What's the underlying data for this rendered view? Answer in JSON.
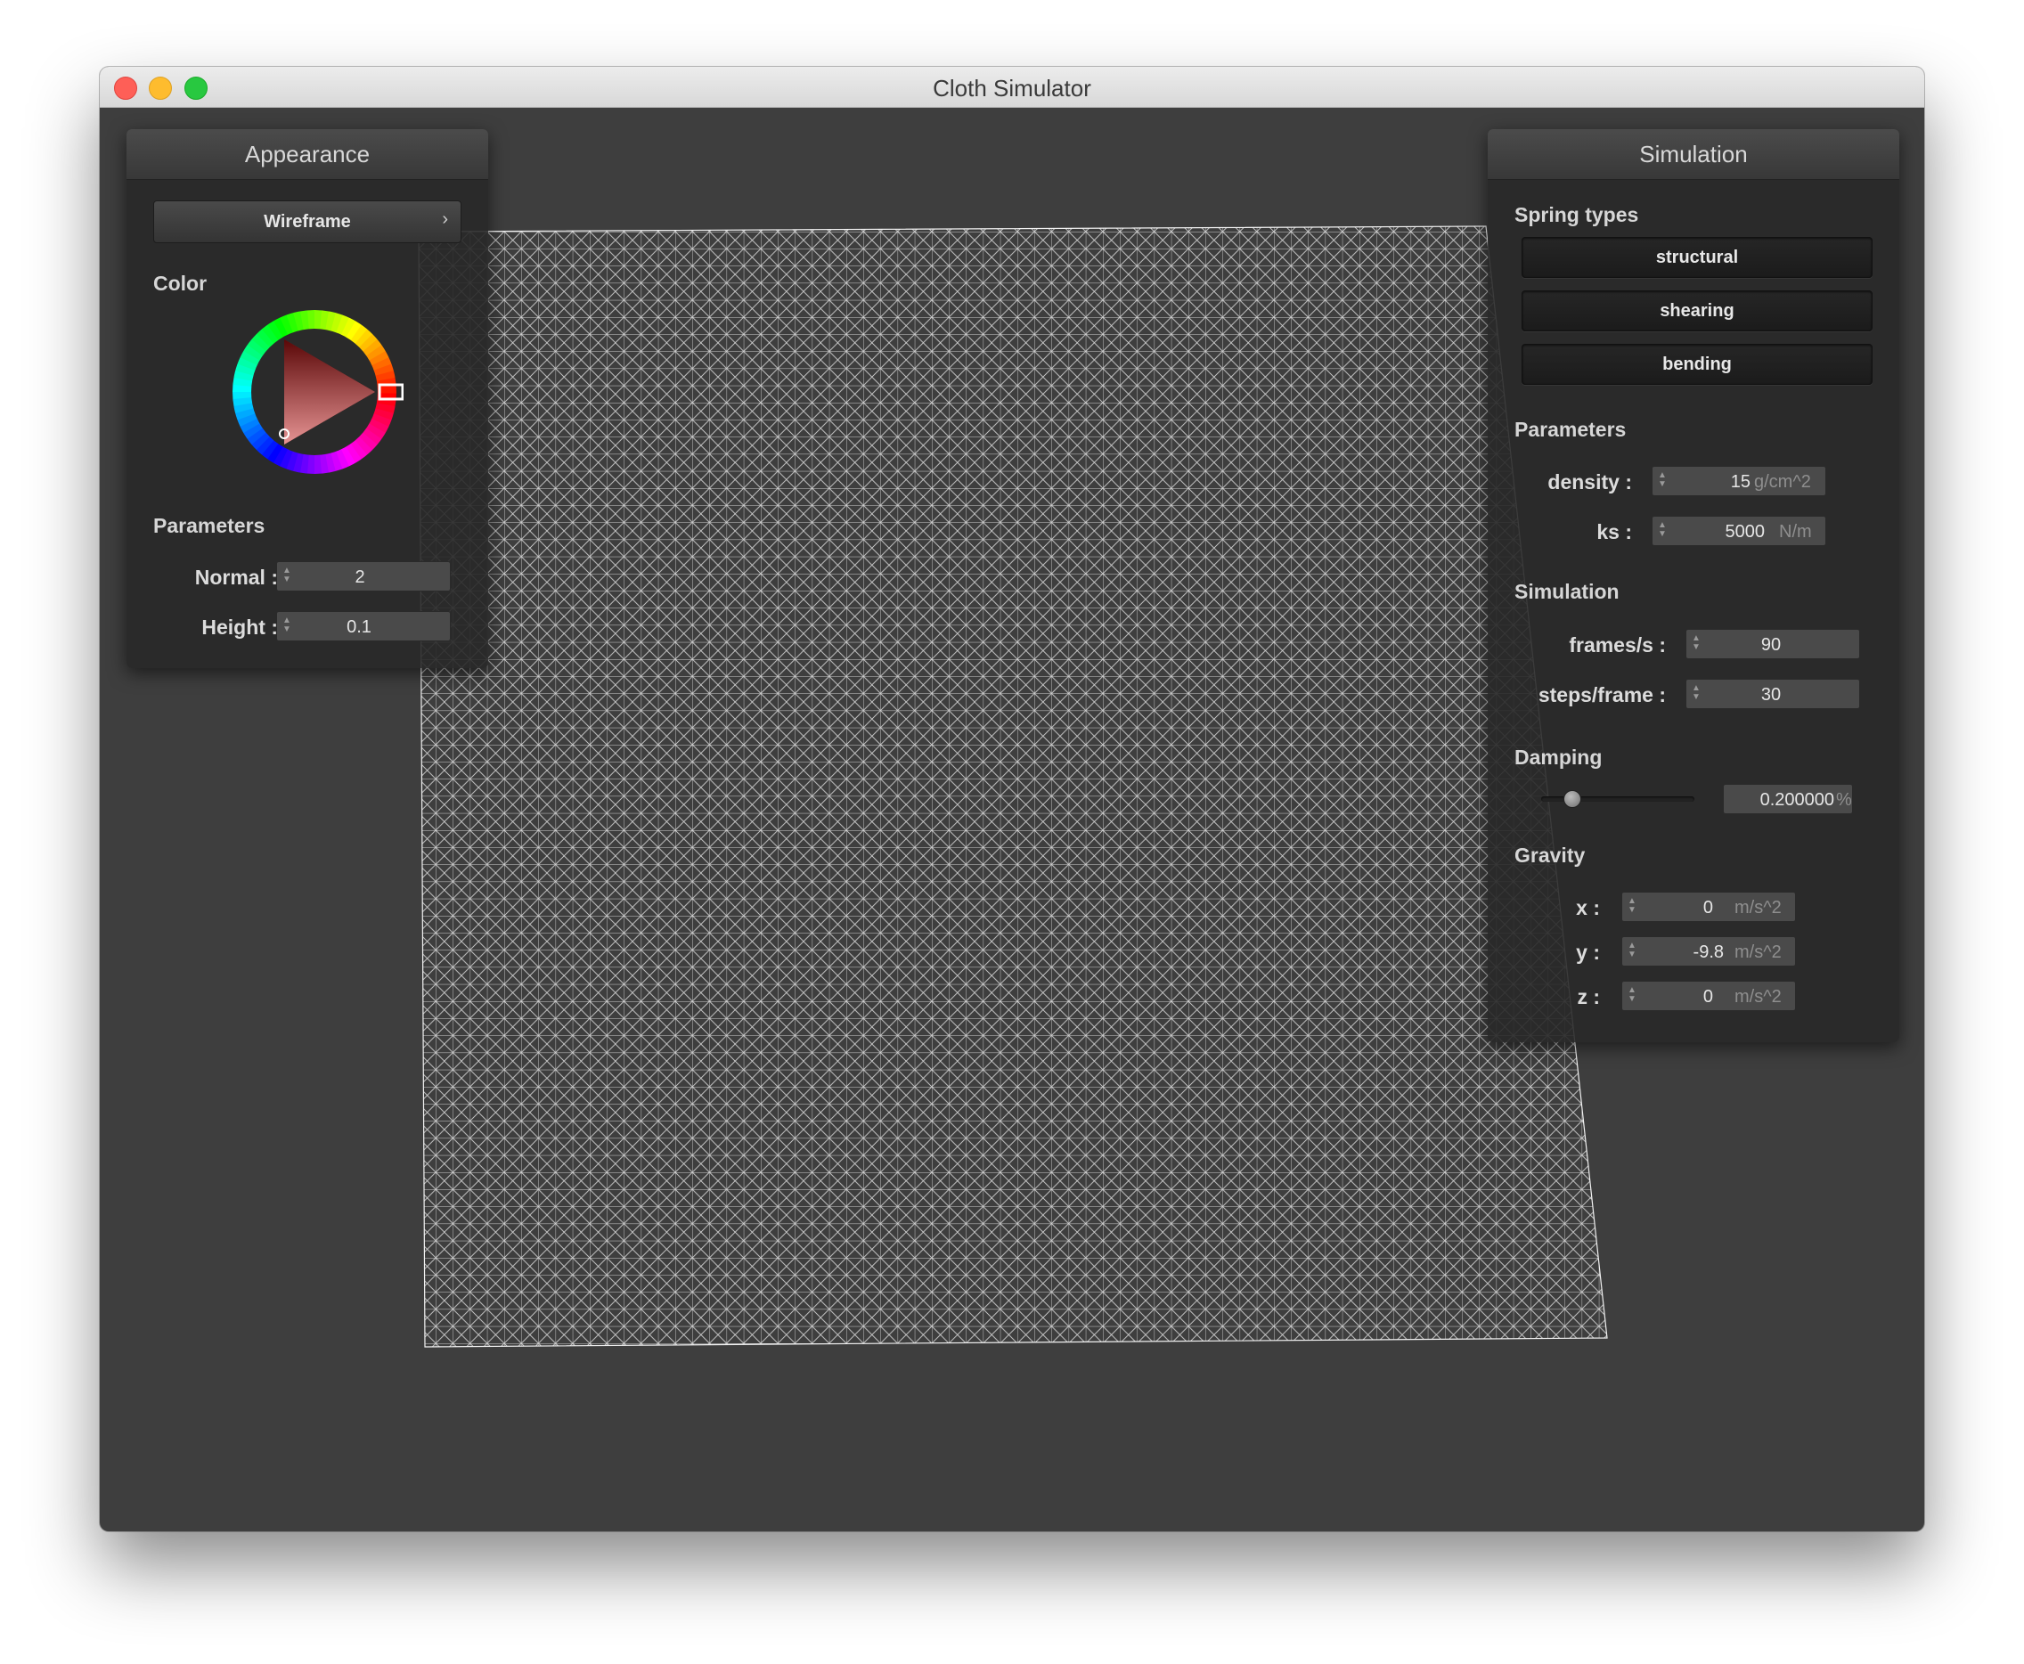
{
  "window": {
    "title": "Cloth Simulator"
  },
  "appearance": {
    "header": "Appearance",
    "shader_button": "Wireframe",
    "shader_chevron": "›",
    "color_label": "Color",
    "selected_color": "#ff1a1a",
    "params_label": "Parameters",
    "normal": {
      "label": "Normal :",
      "value": "2"
    },
    "height": {
      "label": "Height :",
      "value": "0.1"
    }
  },
  "simulation": {
    "header": "Simulation",
    "spring_types_label": "Spring types",
    "springs": [
      "structural",
      "shearing",
      "bending"
    ],
    "params_label": "Parameters",
    "density": {
      "label": "density :",
      "value": "15",
      "unit": "g/cm^2"
    },
    "ks": {
      "label": "ks :",
      "value": "5000",
      "unit": "N/m"
    },
    "sim_label": "Simulation",
    "fps": {
      "label": "frames/s :",
      "value": "90"
    },
    "steps": {
      "label": "steps/frame :",
      "value": "30"
    },
    "damping_label": "Damping",
    "damping": {
      "value": "0.200000",
      "unit": "%",
      "slider_fraction": 0.2
    },
    "gravity_label": "Gravity",
    "gx": {
      "label": "x :",
      "value": "0",
      "unit": "m/s^2"
    },
    "gy": {
      "label": "y :",
      "value": "-9.8",
      "unit": "m/s^2"
    },
    "gz": {
      "label": "z :",
      "value": "0",
      "unit": "m/s^2"
    }
  },
  "colors": {
    "background": "#3e3e3e",
    "cloth_lines": "#f2f2f2",
    "close": "#fe5f57",
    "minimize": "#febc2e",
    "maximize": "#28c840"
  }
}
